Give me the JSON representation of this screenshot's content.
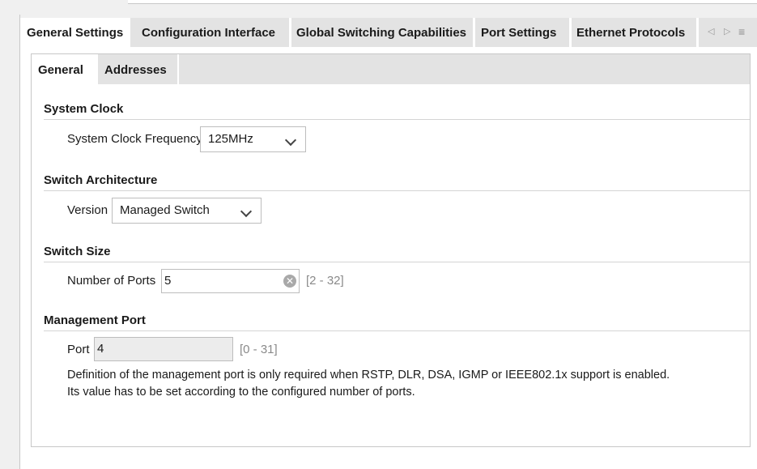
{
  "outer_tabs": [
    {
      "label": "General Settings",
      "active": true
    },
    {
      "label": "Configuration Interface",
      "active": false
    },
    {
      "label": "Global Switching Capabilities",
      "active": false
    },
    {
      "label": "Port Settings",
      "active": false
    },
    {
      "label": "Ethernet Protocols",
      "active": false
    }
  ],
  "tab_controls": {
    "prev": "◁",
    "next": "▷",
    "menu": "≡"
  },
  "inner_tabs": [
    {
      "label": "General",
      "active": true
    },
    {
      "label": "Addresses",
      "active": false
    }
  ],
  "system_clock": {
    "title": "System Clock",
    "frequency_label": "System Clock Frequency",
    "frequency_value": "125MHz"
  },
  "switch_architecture": {
    "title": "Switch Architecture",
    "version_label": "Version",
    "version_value": "Managed Switch"
  },
  "switch_size": {
    "title": "Switch Size",
    "ports_label": "Number of Ports",
    "ports_value": "5",
    "ports_range": "[2 - 32]"
  },
  "management_port": {
    "title": "Management Port",
    "port_label": "Port",
    "port_value": "4",
    "port_range": "[0 - 31]",
    "note_line1": "Definition of the management port is only required when RSTP, DLR, DSA, IGMP or IEEE802.1x support is enabled.",
    "note_line2": "Its value has to be set according to the configured number of ports."
  },
  "colors": {
    "tab_bar": "#e3e3e3",
    "panel": "#ffffff",
    "background": "#f0f0f0"
  }
}
